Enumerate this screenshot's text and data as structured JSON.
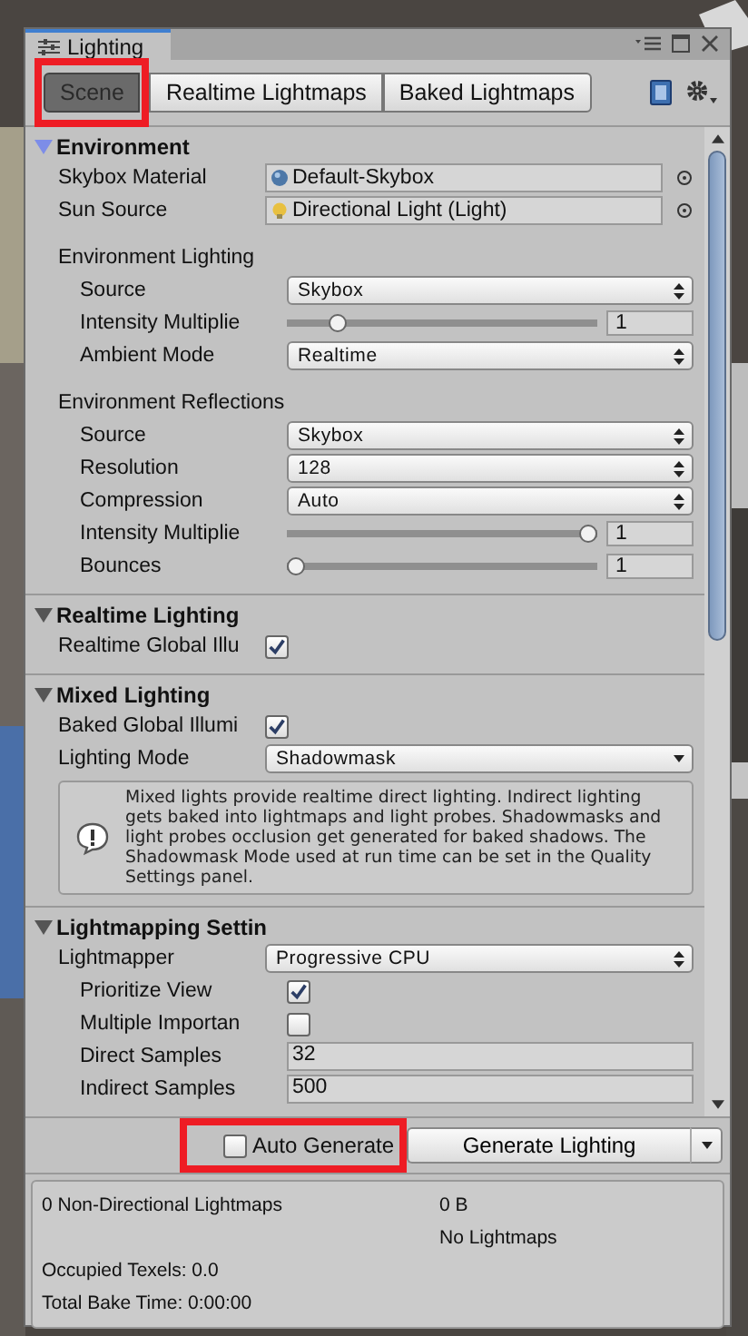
{
  "window": {
    "title": "Lighting"
  },
  "tabs": [
    {
      "label": "Scene",
      "selected": true,
      "highlighted": true
    },
    {
      "label": "Realtime Lightmaps",
      "selected": false,
      "highlighted": false
    },
    {
      "label": "Baked Lightmaps",
      "selected": false,
      "highlighted": false
    }
  ],
  "sections": [
    {
      "title": "Environment",
      "expanded": true,
      "focused": true,
      "items": [
        {
          "kind": "material",
          "label": "Skybox Material",
          "value": "Default-Skybox"
        },
        {
          "kind": "light",
          "label": "Sun Source",
          "value": "Directional Light (Light)"
        },
        {
          "kind": "subheading",
          "label": "Environment Lighting",
          "children": [
            {
              "kind": "dropdown",
              "label": "Source",
              "value": "Skybox"
            },
            {
              "kind": "slider",
              "label": "Intensity Multiplie",
              "level": 0.14,
              "value": "1"
            },
            {
              "kind": "dropdown",
              "label": "Ambient Mode",
              "value": "Realtime"
            }
          ]
        },
        {
          "kind": "subheading",
          "label": "Environment Reflections",
          "children": [
            {
              "kind": "dropdown",
              "label": "Source",
              "value": "Skybox"
            },
            {
              "kind": "dropdown",
              "label": "Resolution",
              "value": "128"
            },
            {
              "kind": "dropdown",
              "label": "Compression",
              "value": "Auto"
            },
            {
              "kind": "slider",
              "label": "Intensity Multiplie",
              "level": 1,
              "value": "1"
            },
            {
              "kind": "slider",
              "label": "Bounces",
              "level": 0,
              "value": "1"
            }
          ]
        }
      ]
    },
    {
      "title": "Realtime Lighting",
      "expanded": true,
      "focused": false,
      "items": [
        {
          "kind": "checkbox",
          "label": "Realtime Global Illu",
          "checked": true
        }
      ]
    },
    {
      "title": "Mixed Lighting",
      "expanded": true,
      "focused": false,
      "items": [
        {
          "kind": "checkbox",
          "label": "Baked Global Illumi",
          "checked": true
        },
        {
          "kind": "popup",
          "label": "Lighting Mode",
          "value": "Shadowmask"
        },
        {
          "kind": "help",
          "text": "Mixed lights provide realtime direct lighting. Indirect lighting gets baked into lightmaps and light probes. Shadowmasks and light probes occlusion get generated for baked shadows. The Shadowmask Mode used at run time can be set in the Quality Settings panel."
        }
      ]
    },
    {
      "title": "Lightmapping Settin",
      "expanded": true,
      "focused": false,
      "items": [
        {
          "kind": "dropdown",
          "label": "Lightmapper",
          "value": "Progressive CPU",
          "children": [
            {
              "kind": "checkbox",
              "label": "Prioritize View",
              "checked": true
            },
            {
              "kind": "checkbox",
              "label": "Multiple Importan",
              "checked": false
            },
            {
              "kind": "number",
              "label": "Direct Samples",
              "value": "32"
            },
            {
              "kind": "number",
              "label": "Indirect Samples",
              "value": "500"
            }
          ]
        }
      ]
    }
  ],
  "auto_generate": {
    "label": "Auto Generate",
    "checked": false,
    "highlighted": true
  },
  "generate_button": {
    "label": "Generate Lighting"
  },
  "stats": {
    "lightmaps": "0 Non-Directional Lightmaps",
    "size": "0 B",
    "note": "No Lightmaps",
    "texels": "Occupied Texels: 0.0",
    "bake_time": "Total Bake Time: 0:00:00"
  }
}
